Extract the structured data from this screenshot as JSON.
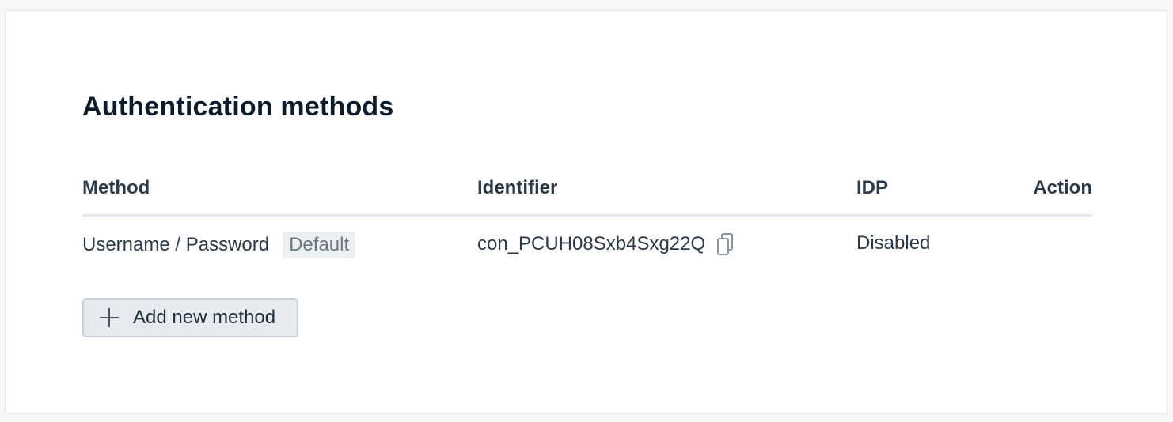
{
  "section": {
    "title": "Authentication methods"
  },
  "table": {
    "headers": {
      "method": "Method",
      "identifier": "Identifier",
      "idp": "IDP",
      "action": "Action"
    },
    "rows": [
      {
        "method": "Username / Password",
        "badge": "Default",
        "identifier": "con_PCUH08Sxb4Sxg22Q",
        "idp": "Disabled",
        "action": ""
      }
    ]
  },
  "add_button": {
    "label": "Add new method",
    "icon": "plus-icon"
  },
  "icons": {
    "copy": "copy-icon"
  }
}
